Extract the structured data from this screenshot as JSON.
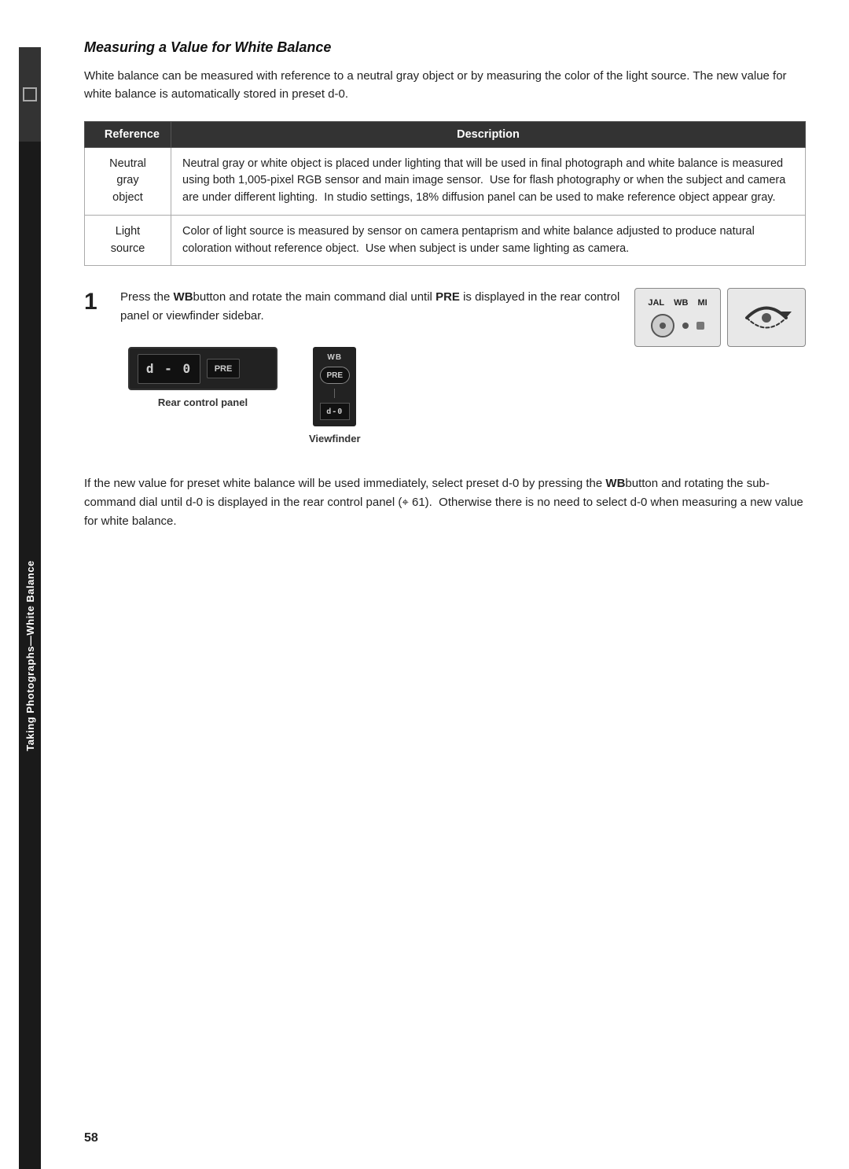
{
  "sidebar": {
    "rotated_text": "Taking Photographs—White Balance"
  },
  "section": {
    "title": "Measuring a Value for White Balance",
    "intro": "White balance can be measured with reference to a neutral gray object or by measuring the color of the light source.  The new value for white balance is automatically stored in preset d-0.",
    "table": {
      "col_reference": "Reference",
      "col_description": "Description",
      "rows": [
        {
          "reference": "Neutral\ngray\nobject",
          "description": "Neutral gray or white object is placed under lighting that will be used in final photograph and white balance is measured using both 1,005-pixel RGB sensor and main image sensor.  Use for flash photography or when the subject and camera are under different lighting.  In studio settings, 18% diffusion panel can be used to make reference object appear gray."
        },
        {
          "reference": "Light\nsource",
          "description": "Color of light source is measured by sensor on camera pentaprism and white balance adjusted to produce natural coloration without reference object.  Use when subject is under same lighting as camera."
        }
      ]
    },
    "step1": {
      "number": "1",
      "text_part1": "Press the ",
      "wb_label": "WB",
      "text_part2": "button and rotate the main command dial until ",
      "pre_label": "PRE",
      "text_part3": " is displayed in the rear control panel or viewfinder sidebar.",
      "rear_panel_label": "Rear control panel",
      "viewfinder_label": "Viewfinder",
      "panel_display_text": "d - 0",
      "panel_pre_text": "PRE",
      "vf_wb_text": "WB",
      "vf_pre_text": "PRE",
      "vf_bottom_text": "d-0"
    },
    "bottom_text": "If the new value for preset white balance will be used immediately, select preset d-0 by pressing the WBbutton and rotating the sub-command dial until d-0 is displayed in the rear control panel (  61).  Otherwise there is no need to select d-0 when measuring a new value for white balance.",
    "bottom_wb": "WB",
    "page_number": "58"
  }
}
